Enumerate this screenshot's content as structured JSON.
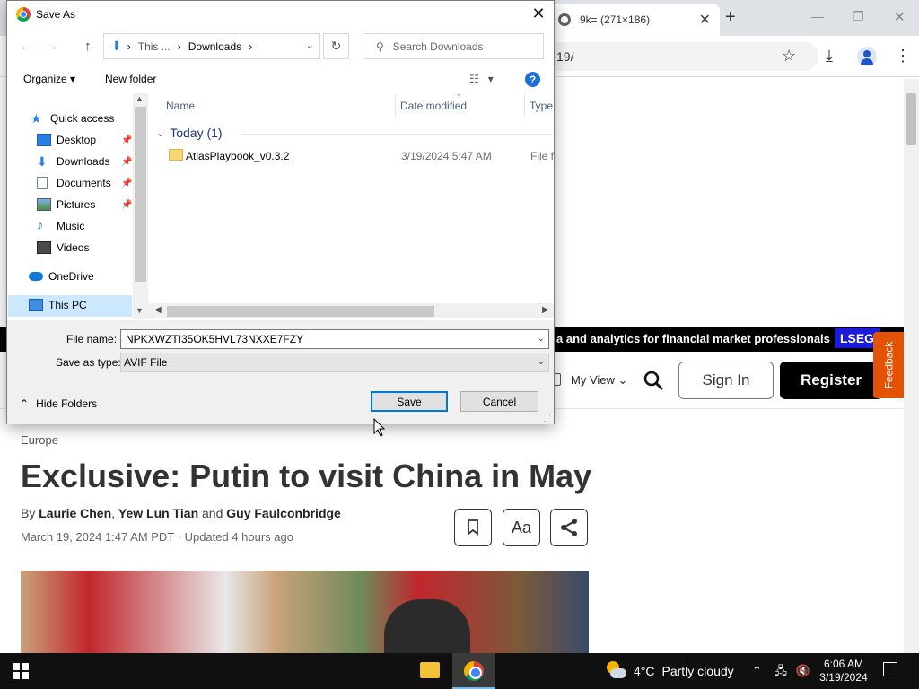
{
  "browser": {
    "tab_title": "9k= (271×186)",
    "new_tab": "+",
    "url_fragment": "19/",
    "page": {
      "banner_text": "a and analytics for financial market professionals",
      "banner_brand": "LSEG",
      "my_view": "My View",
      "sign_in": "Sign In",
      "register": "Register",
      "feedback": "Feedback",
      "section": "Europe",
      "headline": "Exclusive: Putin to visit China in May",
      "byline_prefix": "By",
      "author1": "Laurie Chen",
      "author2": "Yew Lun Tian",
      "byline_and": "and",
      "author3": "Guy Faulconbridge",
      "dateline": "March 19, 2024 1:47 AM PDT · Updated 4 hours ago",
      "text_size_label": "Aa"
    }
  },
  "dialog": {
    "title": "Save As",
    "address": {
      "seg1": "This ...",
      "seg2": "Downloads"
    },
    "search_placeholder": "Search Downloads",
    "toolbar": {
      "organize": "Organize",
      "new_folder": "New folder"
    },
    "nav_pane": {
      "quick_access": "Quick access",
      "items": [
        {
          "label": "Desktop",
          "icon": "desktop-icon"
        },
        {
          "label": "Downloads",
          "icon": "downloads-icon"
        },
        {
          "label": "Documents",
          "icon": "documents-icon"
        },
        {
          "label": "Pictures",
          "icon": "pictures-icon"
        },
        {
          "label": "Music",
          "icon": "music-icon"
        },
        {
          "label": "Videos",
          "icon": "videos-icon"
        }
      ],
      "onedrive": "OneDrive",
      "this_pc": "This PC"
    },
    "columns": {
      "name": "Name",
      "date_modified": "Date modified",
      "type": "Type"
    },
    "groups": [
      {
        "label": "Today (1)",
        "files": [
          {
            "name": "AtlasPlaybook_v0.3.2",
            "date": "3/19/2024 5:47 AM",
            "type": "File fo"
          }
        ]
      }
    ],
    "file_name_label": "File name:",
    "file_name_value": "NPKXWZTI35OK5HVL73NXXE7FZY",
    "save_type_label": "Save as type:",
    "save_type_value": "AVIF File",
    "hide_folders": "Hide Folders",
    "save": "Save",
    "cancel": "Cancel"
  },
  "taskbar": {
    "weather_temp": "4°C",
    "weather_desc": "Partly cloudy",
    "time": "6:06 AM",
    "date": "3/19/2024"
  },
  "colors": {
    "accent_blue": "#0078d7",
    "selection": "#cce8ff",
    "feedback_orange": "#e35205",
    "lseg_blue": "#1b1bdb"
  }
}
